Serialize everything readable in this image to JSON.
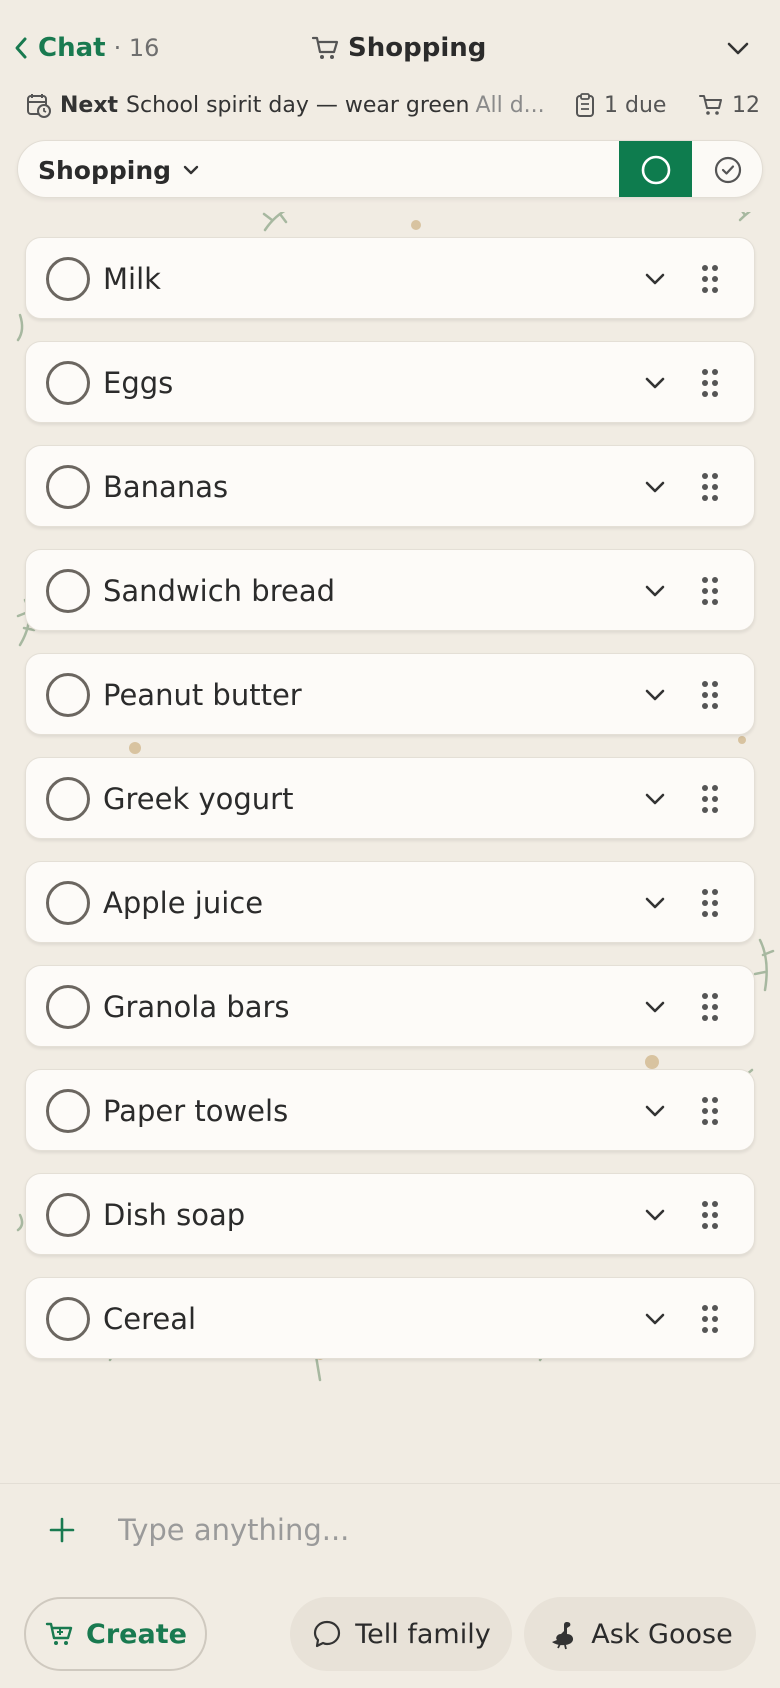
{
  "header": {
    "back_label": "Chat",
    "back_count": "· 16",
    "title": "Shopping",
    "next_label": "Next",
    "next_event": "School spirit day — wear green",
    "next_event_time": "All d...",
    "due_text": "1 due",
    "cart_count": "12"
  },
  "filter": {
    "selected": "Shopping",
    "open_icon": "circle-icon",
    "done_icon": "check-circle-icon"
  },
  "items": [
    {
      "label": "Milk"
    },
    {
      "label": "Eggs"
    },
    {
      "label": "Bananas"
    },
    {
      "label": "Sandwich bread"
    },
    {
      "label": "Peanut butter"
    },
    {
      "label": "Greek yogurt"
    },
    {
      "label": "Apple juice"
    },
    {
      "label": "Granola bars"
    },
    {
      "label": "Paper towels"
    },
    {
      "label": "Dish soap"
    },
    {
      "label": "Cereal"
    }
  ],
  "composer": {
    "placeholder": "Type anything...",
    "create_label": "Create",
    "tell_family_label": "Tell family",
    "ask_goose_label": "Ask Goose"
  },
  "colors": {
    "accent": "#197a50",
    "accent_fill": "#0e7c4e",
    "background": "#f1ece3",
    "card": "#fdfbf8"
  }
}
